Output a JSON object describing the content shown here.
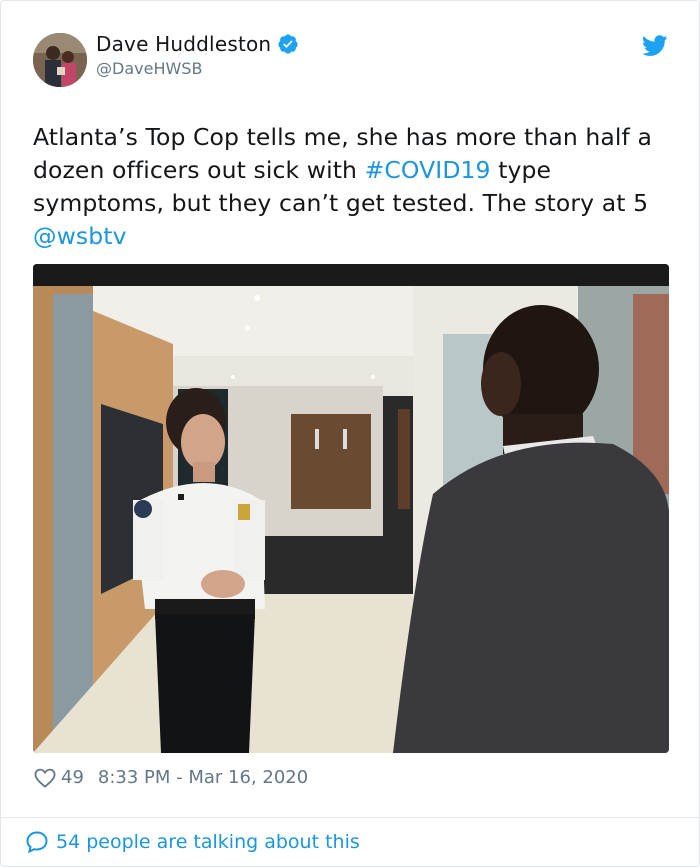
{
  "author": {
    "display_name": "Dave Huddleston",
    "handle": "@DaveHWSB",
    "verified_icon": "verified-badge-icon",
    "avatar_icon": "profile-photo"
  },
  "brand_icon": "twitter-bird-icon",
  "tweet": {
    "text_1": "Atlanta’s Top Cop tells me, she has more than half a dozen officers out sick with ",
    "hashtag": "#COVID19",
    "text_2": " type symptoms, but they can’t get tested. The story at 5 ",
    "mention": "@wsbtv"
  },
  "media": {
    "description_icon": "photo"
  },
  "footer": {
    "like_count": "49",
    "timestamp": "8:33 PM - Mar 16, 2020"
  },
  "conversation": {
    "label": "54 people are talking about this"
  },
  "colors": {
    "link": "#1b95e0",
    "muted": "#657786",
    "text": "#14171a",
    "border": "#e1e8ed"
  }
}
